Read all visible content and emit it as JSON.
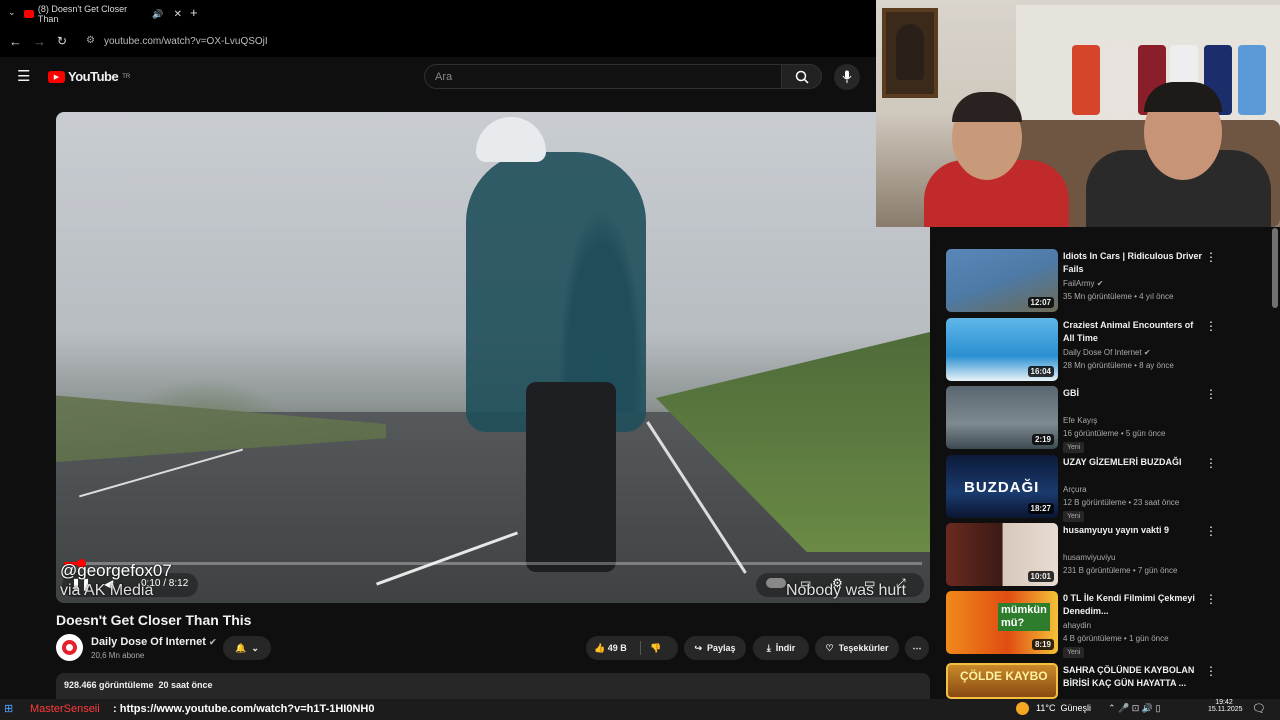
{
  "browser": {
    "tab_title": "(8) Doesn't Get Closer Than",
    "url": "youtube.com/watch?v=OX-LvuQSOjI"
  },
  "youtube": {
    "logo": "YouTube",
    "region": "TR",
    "search_placeholder": "Ara"
  },
  "video": {
    "watermark_user": "@georgefox07",
    "watermark_via": "via AK Media",
    "subtitle": "Nobody was hurt",
    "time": "0:10 / 8:12",
    "progress": 0.02,
    "title": "Doesn't Get Closer Than This",
    "channel": "Daily Dose Of Internet",
    "subscribers": "20,6 Mn abone",
    "likes": "49 B",
    "share": "Paylaş",
    "download": "İndir",
    "thanks": "Teşekkürler",
    "views": "928.466 görüntüleme  20 saat önce"
  },
  "recommendations": [
    {
      "title": "Idiots In Cars | Ridiculous Driver Fails",
      "channel": "FailArmy",
      "meta": "35 Mn görüntüleme • 4 yıl önce",
      "duration": "12:07",
      "verified": true,
      "new": ""
    },
    {
      "title": "Craziest Animal Encounters of All Time",
      "channel": "Daily Dose Of Internet",
      "meta": "28 Mn görüntüleme • 8 ay önce",
      "duration": "16:04",
      "verified": true,
      "new": ""
    },
    {
      "title": "GBİ",
      "channel": "Efe Kayış",
      "meta": "16 görüntüleme • 5 gün önce",
      "duration": "2:19",
      "verified": false,
      "new": "Yeni"
    },
    {
      "title": "UZAY GİZEMLERİ BUZDAĞI",
      "channel": "Arçura",
      "meta": "12 B görüntüleme • 23 saat önce",
      "duration": "18:27",
      "verified": false,
      "new": "Yeni"
    },
    {
      "title": "husamyuyu yayın vakti 9",
      "channel": "husamviyuviyu",
      "meta": "231 B görüntüleme • 7 gün önce",
      "duration": "10:01",
      "verified": false,
      "new": ""
    },
    {
      "title": "0 TL İle Kendi Filmimi Çekmeyi Denedim...",
      "channel": "ahaydin",
      "meta": "4 B görüntüleme • 1 gün önce",
      "duration": "8:19",
      "verified": false,
      "new": "Yeni"
    },
    {
      "title": "SAHRA ÇÖLÜNDE KAYBOLAN BİRİSİ KAÇ GÜN HAYATTA ...",
      "channel": "",
      "meta": "",
      "duration": "",
      "verified": false,
      "new": ""
    }
  ],
  "thumb_texts": {
    "buzdagi": "BUZDAĞI",
    "mumkun": "mümkün mü?",
    "golde": "ÇÖLDE KAYBO"
  },
  "taskbar": {
    "chat_name": "MasterSenseii",
    "chat_msg": ": https://www.youtube.com/watch?v=h1T-1HI0NH0",
    "weather": "11°C  Güneşli",
    "time": "19:42",
    "date": "15.11.2025"
  },
  "colors": {
    "accent": "#ff0000",
    "bg": "#0f0f0f",
    "chip": "#272727"
  }
}
